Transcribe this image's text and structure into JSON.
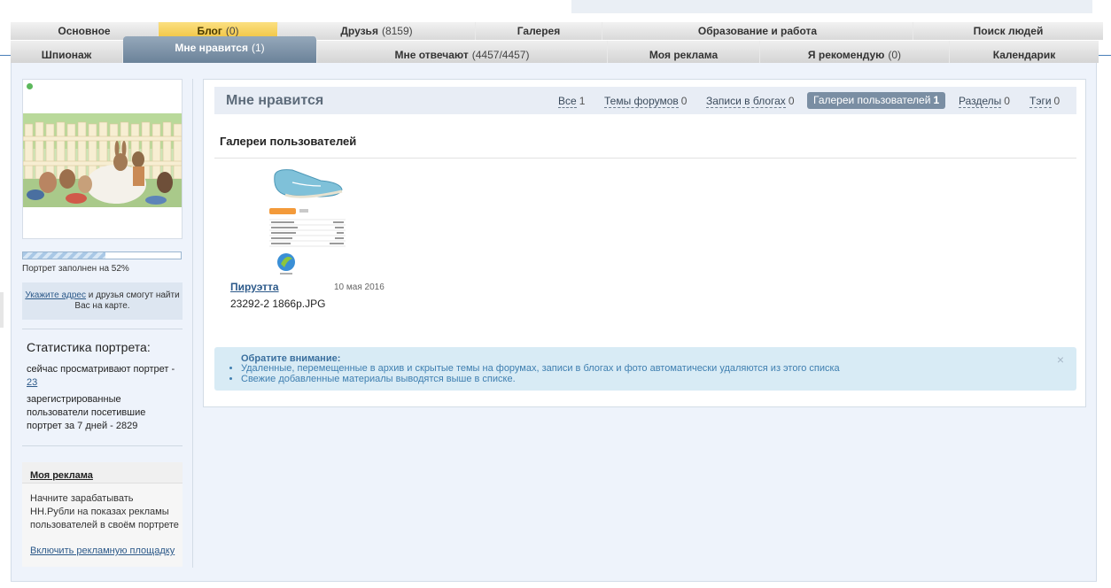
{
  "tabs_row1": [
    {
      "label": "Основное",
      "count": ""
    },
    {
      "label": "Блог",
      "count": "(0)"
    },
    {
      "label": "Друзья",
      "count": "(8159)"
    },
    {
      "label": "Галерея",
      "count": ""
    },
    {
      "label": "Образование и работа",
      "count": ""
    },
    {
      "label": "Поиск людей",
      "count": ""
    }
  ],
  "tabs_row2": [
    {
      "label": "Шпионаж",
      "count": ""
    },
    {
      "label": "Мне нравится",
      "count": "(1)"
    },
    {
      "label": "Мне отвечают",
      "count": "(4457/4457)"
    },
    {
      "label": "Моя реклама",
      "count": ""
    },
    {
      "label": "Я рекомендую",
      "count": "(0)"
    },
    {
      "label": "Календарик",
      "count": ""
    }
  ],
  "profile": {
    "online": true,
    "portrait_fill_fraction": 0.52,
    "portrait_label": "Портрет заполнен на 52%",
    "map_link": "Укажите адрес",
    "map_text": "и друзья смогут найти Вас на карте."
  },
  "stats": {
    "title": "Статистика портрета:",
    "viewing_text": "сейчас просматривают портрет -",
    "viewing_count": "23",
    "visitors_text": "зарегистрированные пользователи посетившие портрет за 7 дней - 2829"
  },
  "ad": {
    "title": "Моя реклама",
    "text": "Начните зарабатывать НН.Рубли на показах рекламы пользователей в своём портрете",
    "link": "Включить рекламную площадку"
  },
  "likes": {
    "title": "Мне нравится",
    "filters": [
      {
        "label": "Все",
        "count": "1"
      },
      {
        "label": "Темы форумов",
        "count": "0"
      },
      {
        "label": "Записи в блогах",
        "count": "0"
      },
      {
        "label": "Галереи пользователей",
        "count": "1"
      },
      {
        "label": "Разделы",
        "count": "0"
      },
      {
        "label": "Тэги",
        "count": "0"
      }
    ],
    "section_title": "Галереи пользователей",
    "item": {
      "author": "Пируэтта",
      "date": "10 мая 2016",
      "filename": "23292-2 1866р.JPG"
    },
    "notice": {
      "title": "Обратите внимание:",
      "lines": [
        "Удаленные, перемещенные в архив и скрытые темы на форумах, записи в блогах и фото автоматически удаляются из этого списка",
        "Свежие добавленные материалы выводятся выше в списке."
      ],
      "close": "×"
    }
  },
  "colors": {
    "active_tab_yellow": "#f1c33e",
    "active_tab_blue": "#7a8ea3",
    "link": "#2d5a8a",
    "online": "#5cb85c"
  }
}
